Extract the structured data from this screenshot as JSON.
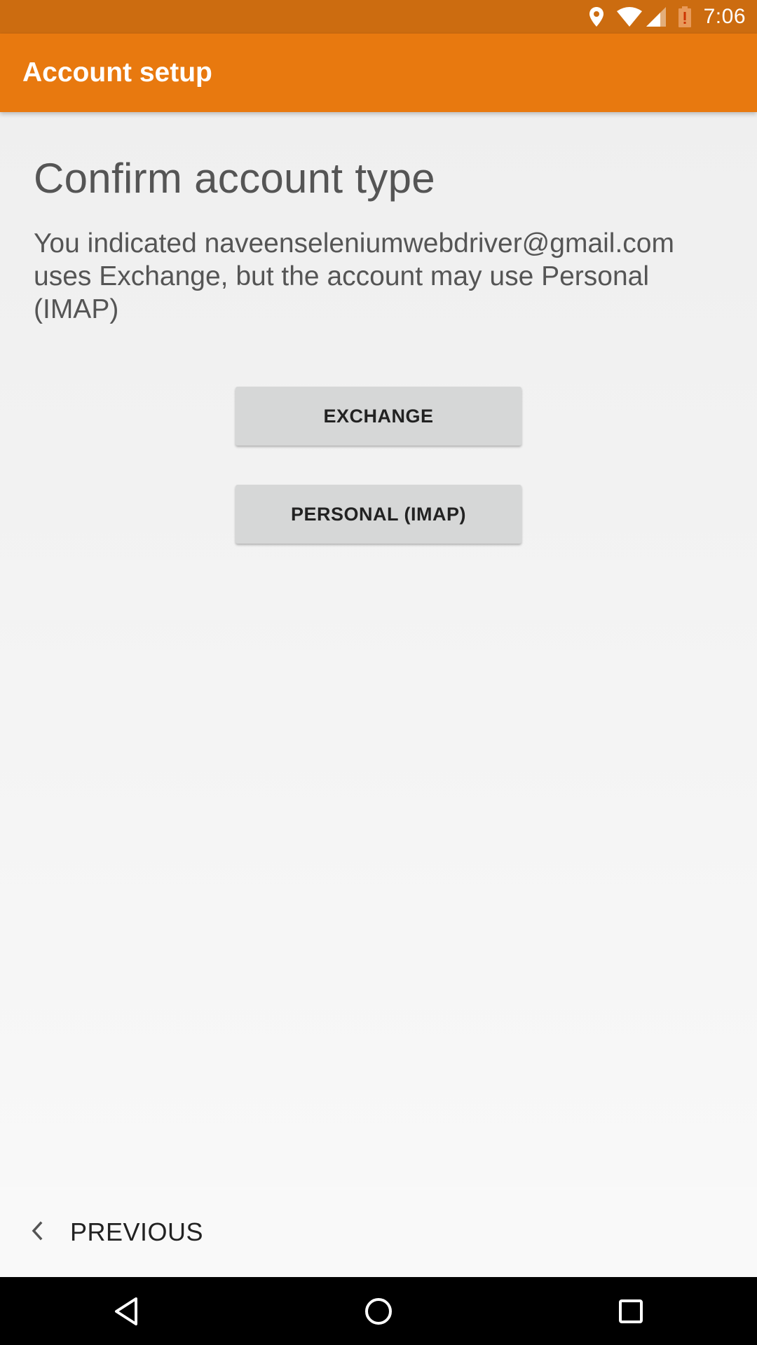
{
  "status_bar": {
    "time": "7:06",
    "icons": [
      "location-icon",
      "wifi-icon",
      "signal-icon",
      "battery-alert-icon"
    ]
  },
  "app_bar": {
    "title": "Account setup"
  },
  "main": {
    "heading": "Confirm account type",
    "description": "You indicated naveenseleniumwebdriver@gmail.com uses Exchange, but the account may use Personal (IMAP)",
    "buttons": {
      "exchange": "EXCHANGE",
      "personal_imap": "PERSONAL (IMAP)"
    }
  },
  "bottom_bar": {
    "previous_label": "PREVIOUS",
    "previous_icon": "chevron-left-icon"
  },
  "nav_bar": {
    "icons": [
      "back-icon",
      "home-icon",
      "recents-icon"
    ]
  },
  "colors": {
    "status_bar": "#cc6c10",
    "app_bar": "#e8790f",
    "button_bg": "#d6d7d7",
    "battery_alert": "#e8790f"
  }
}
